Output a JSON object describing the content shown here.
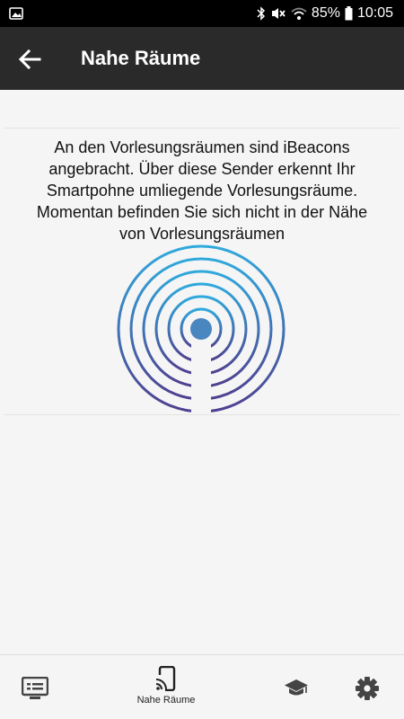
{
  "status_bar": {
    "battery": "85%",
    "time": "10:05",
    "icons": [
      "image-icon",
      "bluetooth-icon",
      "mute-icon",
      "wifi-icon",
      "battery-icon"
    ]
  },
  "app_bar": {
    "title": "Nahe Räume",
    "back_icon": "arrow-left-icon"
  },
  "main": {
    "message_lines": [
      "An den Vorlesungsräumen sind iBeacons",
      "angebracht. Über diese Sender erkennt Ihr",
      "Smartpohne umliegende Vorlesungsräume.",
      "Momentan befinden Sie sich nicht in der Nähe",
      "von Vorlesungsräumen"
    ],
    "beacon_icon": "ibeacon-signal-icon",
    "beacon_colors": [
      "#2fa9dc",
      "#4f3f8f",
      "#4a86bf"
    ]
  },
  "bottom_nav": {
    "items": [
      {
        "icon": "lecture-list-icon",
        "label": ""
      },
      {
        "icon": "cast-phone-icon",
        "label": "Nahe Räume"
      },
      {
        "icon": "graduation-cap-icon",
        "label": ""
      },
      {
        "icon": "gear-icon",
        "label": ""
      }
    ]
  }
}
